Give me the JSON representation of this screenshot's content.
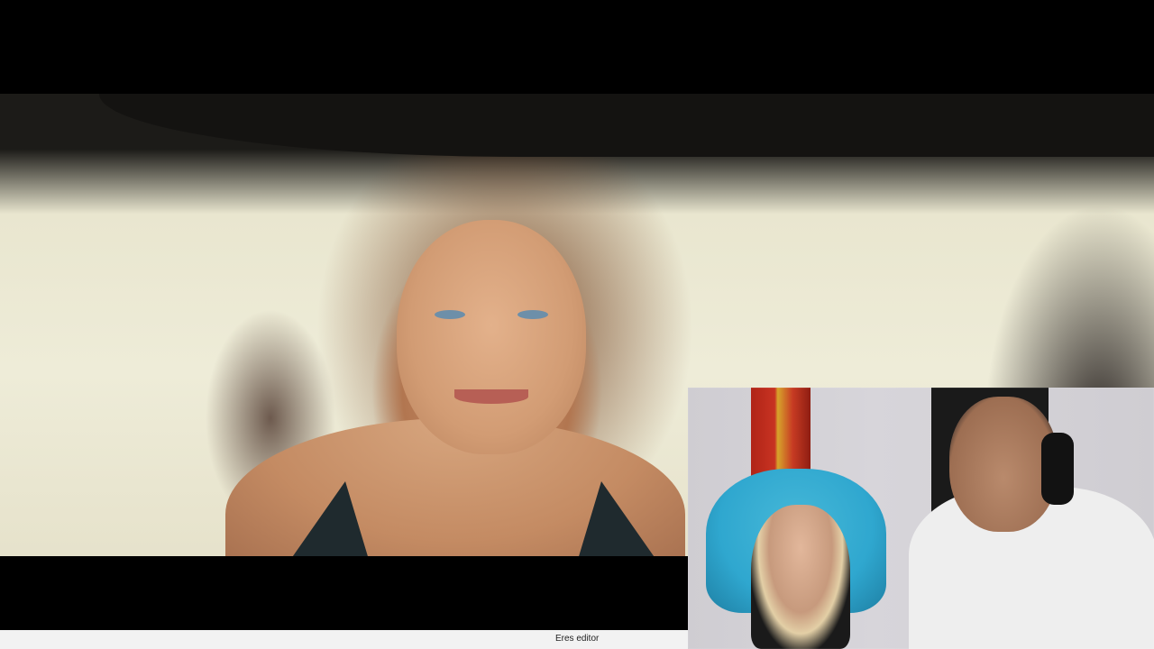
{
  "player": {
    "status_text": "Eres editor"
  },
  "colors": {
    "background": "#000000",
    "status_strip": "#f2f2f2",
    "chair_accent": "#2fa7cf"
  }
}
